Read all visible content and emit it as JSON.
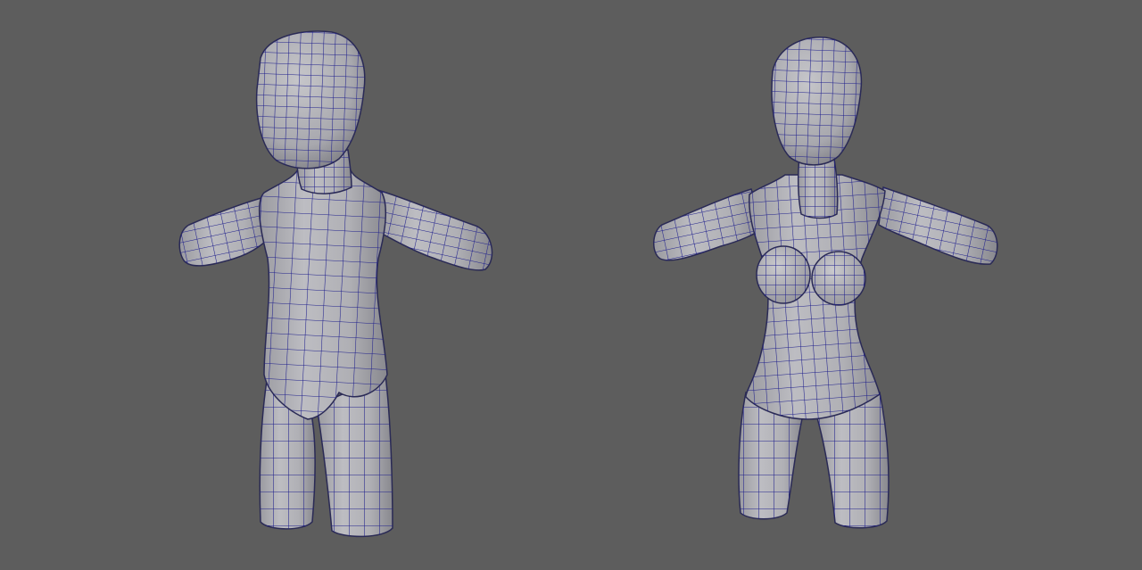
{
  "viewport": {
    "background_color": "#5d5d5d",
    "mesh_surface_color": "#b4b4b8",
    "mesh_shadow_color": "#6e6e74",
    "wireframe_color": "#1f1f8c",
    "shading_mode": "wireframe-on-shaded"
  },
  "models": [
    {
      "id": "male-base-mesh",
      "pose": "A-pose",
      "icon": "mesh-icon"
    },
    {
      "id": "female-base-mesh",
      "pose": "A-pose",
      "icon": "mesh-icon"
    }
  ]
}
